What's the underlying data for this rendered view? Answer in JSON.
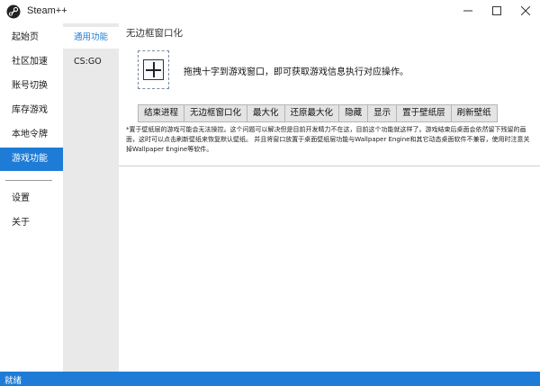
{
  "window": {
    "title": "Steam++",
    "logo_icon": "steam-logo-icon",
    "controls": {
      "minimize_icon": "minimize-icon",
      "maximize_icon": "maximize-icon",
      "close_icon": "close-icon"
    }
  },
  "sidebar": {
    "items": [
      {
        "label": "起始页",
        "active": false
      },
      {
        "label": "社区加速",
        "active": false
      },
      {
        "label": "账号切换",
        "active": false
      },
      {
        "label": "库存游戏",
        "active": false
      },
      {
        "label": "本地令牌",
        "active": false
      },
      {
        "label": "游戏功能",
        "active": true
      }
    ],
    "bottom_items": [
      {
        "label": "设置"
      },
      {
        "label": "关于"
      }
    ]
  },
  "subnav": {
    "items": [
      {
        "label": "通用功能",
        "active": true
      },
      {
        "label": "CS:GO",
        "active": false
      }
    ]
  },
  "main": {
    "title": "无边框窗口化",
    "drag_icon": "crosshair-icon",
    "drag_hint": "拖拽十字到游戏窗口，即可获取游戏信息执行对应操作。",
    "buttons": [
      "结束进程",
      "无边框窗口化",
      "最大化",
      "还原最大化",
      "隐藏",
      "显示",
      "置于壁纸层",
      "刷新壁纸"
    ],
    "note": "*置于壁纸层的游戏可能会无法操控。这个问题可以解决但是目前开发精力不在这，目前这个功能就这样了。游戏结束后桌面会依然留下残留的画面，这时可以点击刷新壁纸来恢复默认壁纸。 并且将窗口放置于桌面壁纸层功能与Wallpaper Engine和其它动态桌面软件不兼容，使用时注意关掉Wallpaper Engine等软件。"
  },
  "status": {
    "text": "就绪"
  },
  "colors": {
    "accent": "#1e7cd6",
    "subnav_bg": "#e9e9e9",
    "button_bg": "#e4e4e4"
  }
}
